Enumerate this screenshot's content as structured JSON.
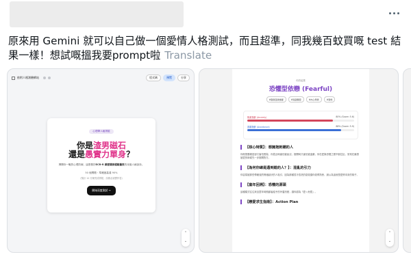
{
  "post": {
    "text": "原來用 Gemini 就可以自己做一個愛情人格測試，而且超準，同我幾百蚊買嘅 test 結果一樣！想試嘅搵我要prompt啦",
    "translate_label": "Translate"
  },
  "card1": {
    "toolbar": {
      "title": "依附人格測驗網站",
      "share_label": "分享",
      "code_label": "程式碼",
      "preview_label": "預覽"
    },
    "pill": "心理學人格測驗",
    "headline": {
      "line1_prefix": "你是",
      "line1_highlight": "渣男磁石",
      "line2_prefix": "還是",
      "line2_highlight": "愚實力單身",
      "line2_suffix": "？"
    },
    "subtitle_prefix": "揭開你一戰的心理防線，這是基於",
    "subtitle_bold": "ECR-R 親密關係經驗量表",
    "subtitle_suffix": "的深度人格剖析。",
    "stat": "50 個問題・準確度高達 90%",
    "stat_note": "(預計 10 分鐘完成測驗，請務必誠實作答)",
    "cta": "開始深度測試 →"
  },
  "card2": {
    "small_label": "你的結果",
    "title": "恐懼型依戀 (Fearful)",
    "tags": [
      "#容易自我懷疑",
      "#渴望親密",
      "#內心矛盾",
      "#受傷"
    ],
    "bars": [
      {
        "label": "焦慮指數 (Anxiety)",
        "value_text": "80% (Score: 5.6)",
        "percent": 80
      },
      {
        "label": "迴避指數 (Avoidance)",
        "value_text": "88% (Score: 5.9)",
        "percent": 88
      }
    ],
    "sections": [
      {
        "title": "【核心特質】：想擁抱刺蝟的人",
        "body": "你既想要親密卻又害怕受傷，你靠近時害怕被吞沒，推開時又害怕被遺棄，你在愛與恐懼之間不斷拉扯，常常在最想被愛的時候先一步推開對方。"
      },
      {
        "title": "【為何你總是遇到錯的人？】：混亂的引力",
        "body": "你容易被那些帶著強烈情緒起伏的人吸引，因為那種忽冷忽熱的感覺讓你覺得熟悉，誤以為這就是愛情本來的樣子。"
      },
      {
        "title": "【童年回溯】：恐懼的源頭",
        "body": "這種模式往往來自童年時照顧者給予的矛盾訊號，讓你認為「愛＝危險」。"
      },
      {
        "title": "【戀愛求生指南】：Action Plan",
        "body": ""
      }
    ]
  }
}
